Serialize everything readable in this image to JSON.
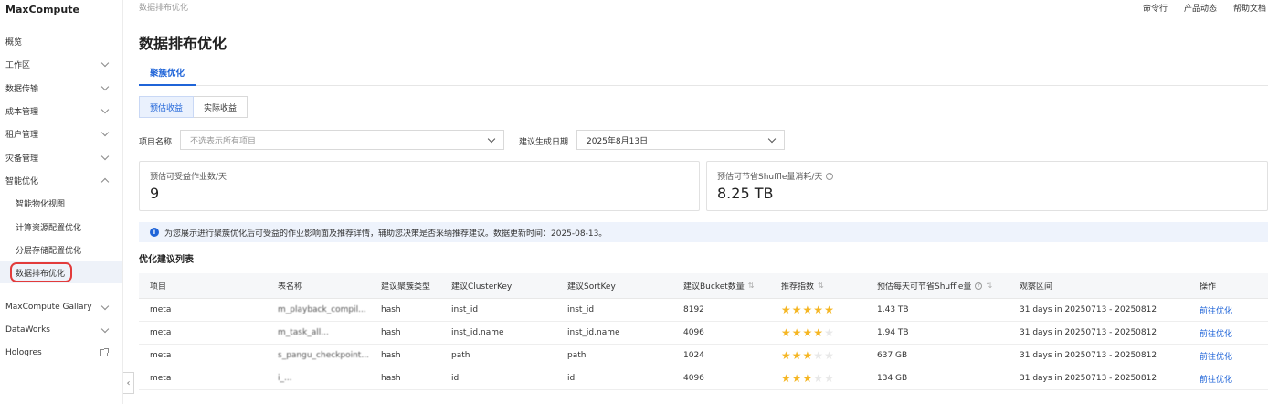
{
  "app": {
    "brand": "MaxCompute"
  },
  "sidebar": {
    "items": [
      {
        "label": "概览",
        "chevron": ""
      },
      {
        "label": "工作区",
        "chevron": "down"
      },
      {
        "label": "数据传输",
        "chevron": "down"
      },
      {
        "label": "成本管理",
        "chevron": "down"
      },
      {
        "label": "租户管理",
        "chevron": "down"
      },
      {
        "label": "灾备管理",
        "chevron": "down"
      },
      {
        "label": "智能优化",
        "chevron": "up"
      }
    ],
    "sub_items": [
      {
        "label": "智能物化视图"
      },
      {
        "label": "计算资源配置优化"
      },
      {
        "label": "分层存储配置优化"
      },
      {
        "label": "数据排布优化",
        "active": true
      }
    ],
    "bottom_items": [
      {
        "label": "MaxCompute Gallary",
        "chevron": "down"
      },
      {
        "label": "DataWorks",
        "chevron": "down"
      },
      {
        "label": "Hologres",
        "icon": "external-link-icon"
      }
    ],
    "collapse_glyph": "‹"
  },
  "header": {
    "breadcrumb": "数据排布优化",
    "links": [
      "命令行",
      "产品动态",
      "帮助文档"
    ]
  },
  "page": {
    "title": "数据排布优化",
    "tab": "聚簇优化",
    "segments": [
      "预估收益",
      "实际收益"
    ],
    "filters": {
      "project_label": "项目名称",
      "project_placeholder": "不选表示所有项目",
      "date_label": "建议生成日期",
      "date_value": "2025年8月13日"
    },
    "cards": [
      {
        "label": "预估可受益作业数/天",
        "value": "9"
      },
      {
        "label": "预估可节省Shuffle量消耗/天",
        "value": "8.25 TB",
        "help": "?"
      }
    ],
    "info_icon": "i",
    "info": "为您展示进行聚簇优化后可受益的作业影响面及推荐详情，辅助您决策是否采纳推荐建议。数据更新时间：2025-08-13。",
    "list_title": "优化建议列表"
  },
  "table": {
    "sort_glyph": "⇅",
    "star_glyph": "★",
    "help_glyph": "?",
    "headers": [
      "项目",
      "表名称",
      "建议聚簇类型",
      "建议ClusterKey",
      "建议SortKey",
      "建议Bucket数量",
      "推荐指数",
      "预估每天可节省Shuffle量",
      "观察区间",
      "操作"
    ],
    "rows": [
      {
        "project": "meta",
        "table": "m_playback_compil...",
        "type": "hash",
        "cluster_key": "inst_id",
        "sort_key": "inst_id",
        "bucket": "8192",
        "stars": 5,
        "shuffle": "1.43 TB",
        "range": "31 days in 20250713 - 20250812",
        "action": "前往优化"
      },
      {
        "project": "meta",
        "table": "m_task_all...",
        "type": "hash",
        "cluster_key": "inst_id,name",
        "sort_key": "inst_id,name",
        "bucket": "4096",
        "stars": 4,
        "shuffle": "1.94 TB",
        "range": "31 days in 20250713 - 20250812",
        "action": "前往优化"
      },
      {
        "project": "meta",
        "table": "s_pangu_checkpoint...",
        "type": "hash",
        "cluster_key": "path",
        "sort_key": "path",
        "bucket": "1024",
        "stars": 3,
        "shuffle": "637 GB",
        "range": "31 days in 20250713 - 20250812",
        "action": "前往优化"
      },
      {
        "project": "meta",
        "table": "i_...",
        "type": "hash",
        "cluster_key": "id",
        "sort_key": "id",
        "bucket": "4096",
        "stars": 3,
        "shuffle": "134 GB",
        "range": "31 days in 20250713 - 20250812",
        "action": "前往优化"
      }
    ]
  }
}
